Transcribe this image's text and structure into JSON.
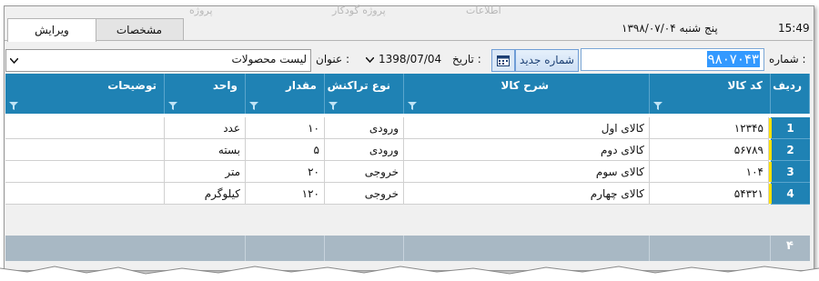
{
  "background_text": {
    "left": "اطلاعات",
    "middle": "پروژه گودکار",
    "right": "پروژه"
  },
  "tabs": [
    {
      "label": "ویرایش",
      "active": true
    },
    {
      "label": "مشخصات",
      "active": false
    }
  ],
  "header": {
    "time": "15:49",
    "day_date": "پنج شنبه ۱۳۹۸/۰۷/۰۴"
  },
  "form": {
    "number_label": "شماره :",
    "number_value": "۹۸۰۷۰۴۳",
    "new_number_button": "شماره جدید",
    "date_label": "تاریخ :",
    "date_value": "1398/07/04",
    "title_label": "عنوان :",
    "title_value": "لیست محصولات"
  },
  "grid": {
    "columns": [
      "ردیف",
      "کد کالا",
      "شرح کالا",
      "نوع تراکنش",
      "مقدار",
      "واحد",
      "توضیحات"
    ],
    "rows": [
      {
        "num": "1",
        "code": "۱۲۳۴۵",
        "desc": "کالای اول",
        "type": "ورودی",
        "qty": "۱۰",
        "unit": "عدد",
        "notes": ""
      },
      {
        "num": "2",
        "code": "۵۶۷۸۹",
        "desc": "کالای دوم",
        "type": "ورودی",
        "qty": "۵",
        "unit": "بسته",
        "notes": ""
      },
      {
        "num": "3",
        "code": "۱۰۴",
        "desc": "کالای سوم",
        "type": "خروجی",
        "qty": "۲۰",
        "unit": "متر",
        "notes": ""
      },
      {
        "num": "4",
        "code": "۵۴۳۲۱",
        "desc": "کالای چهارم",
        "type": "خروجی",
        "qty": "۱۲۰",
        "unit": "کیلوگرم",
        "notes": ""
      }
    ],
    "footer_count": "۴"
  },
  "colors": {
    "header_bg": "#1f82b4",
    "row_marker": "#ffe000",
    "footer_bg": "#a8b8c4"
  },
  "icons": [
    "filter-icon",
    "calendar-icon",
    "chevron-down-icon"
  ]
}
